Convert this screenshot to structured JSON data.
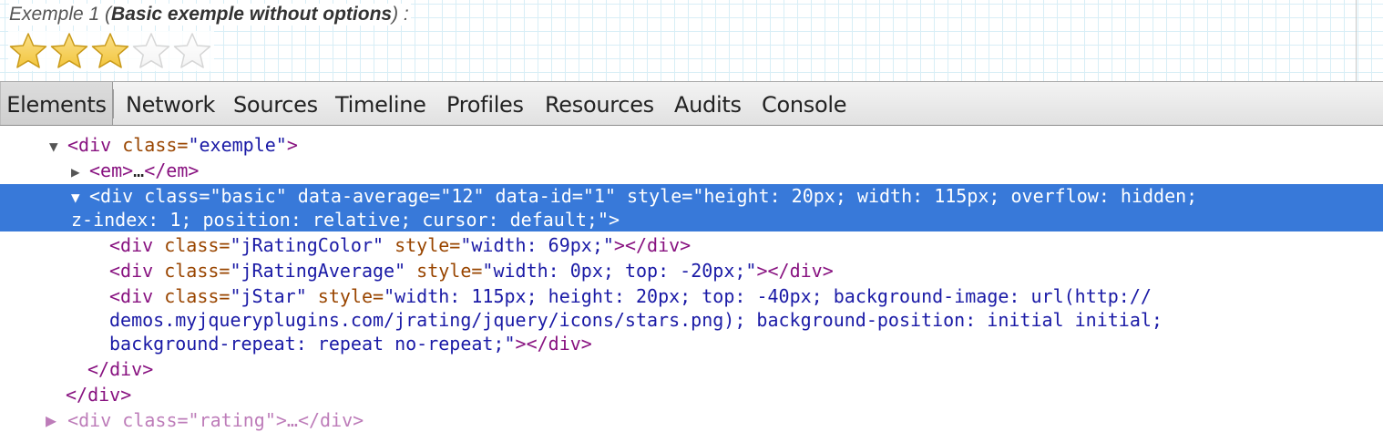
{
  "preview": {
    "title_prefix": "Exemple 1 (",
    "title_bold": "Basic exemple without options",
    "title_suffix": ") :",
    "rating": {
      "filled_stars": 3,
      "total_stars": 5
    },
    "colors": {
      "star_filled": "#f2c53d",
      "star_empty": "#f4f4f4",
      "grid": "#d8eef6"
    }
  },
  "toolbar": {
    "tabs": [
      "Elements",
      "Network",
      "Sources",
      "Timeline",
      "Profiles",
      "Resources",
      "Audits",
      "Console"
    ],
    "active_tab": "Elements"
  },
  "dom": {
    "l1": {
      "open": "<div",
      "attr1": " class=",
      "val1": "\"exemple\"",
      "close": ">"
    },
    "l2": {
      "open": "<em>",
      "ellipsis": "…",
      "close": "</em>"
    },
    "l3": {
      "open": "<div",
      "a1": " class=",
      "v1": "\"basic\"",
      "a2": " data-average=",
      "v2": "\"12\"",
      "a3": " data-id=",
      "v3": "\"1\"",
      "a4": " style=",
      "v4a": "\"height: 20px; width: 115px; overflow: hidden;",
      "v4b": "z-index: 1; position: relative; cursor: default;\"",
      "close": ">"
    },
    "l4": {
      "open": "<div",
      "a1": " class=",
      "v1": "\"jRatingColor\"",
      "a2": " style=",
      "v2": "\"width: 69px;\"",
      "close": "></div>"
    },
    "l5": {
      "open": "<div",
      "a1": " class=",
      "v1": "\"jRatingAverage\"",
      "a2": " style=",
      "v2": "\"width: 0px; top: -20px;\"",
      "close": "></div>"
    },
    "l6": {
      "open": "<div",
      "a1": " class=",
      "v1": "\"jStar\"",
      "a2": " style=",
      "v2a": "\"width: 115px; height: 20px; top: -40px; background-image: url(http://",
      "v2b": "demos.myjqueryplugins.com/jrating/jquery/icons/stars.png); background-position: initial initial;",
      "v2c": "background-repeat: repeat no-repeat;\"",
      "close": "></div>"
    },
    "l7": {
      "close": "</div>"
    },
    "l8": {
      "close": "</div>"
    },
    "l9": {
      "partial": "▶ <div class=\"rating\">…</div>"
    }
  }
}
